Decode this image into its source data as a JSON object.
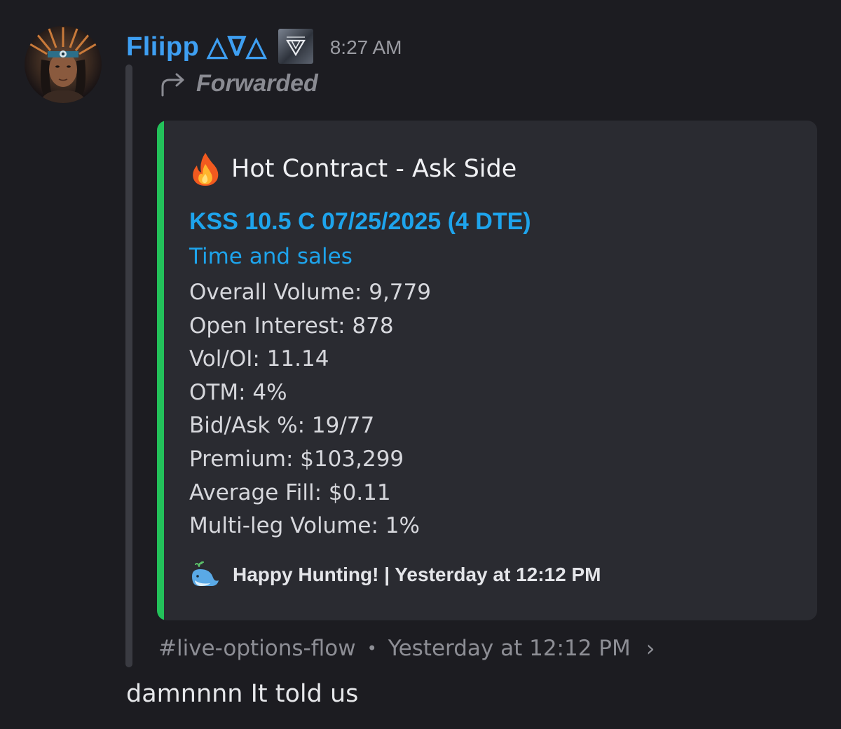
{
  "message": {
    "username": "Fliipp △∇△",
    "timestamp": "8:27 AM",
    "forwarded_label": "Forwarded",
    "reply_text": "damnnnn It told us"
  },
  "embed": {
    "accent_color": "#23c15a",
    "title_icon": "fire-emoji",
    "title": "Hot Contract - Ask Side",
    "contract_link": "KSS 10.5 C 07/25/2025 (4 DTE)",
    "sales_link": "Time and sales",
    "stats": [
      "Overall Volume: 9,779",
      "Open Interest: 878",
      "Vol/OI: 11.14",
      "OTM: 4%",
      "Bid/Ask %: 19/77",
      "Premium: $103,299",
      "Average Fill: $0.11",
      "Multi-leg Volume: 1%"
    ],
    "footer_icon": "whale-emoji",
    "footer_text": "Happy Hunting! | Yesterday at 12:12 PM"
  },
  "source": {
    "channel": "#live-options-flow",
    "separator": "•",
    "time": "Yesterday at 12:12 PM",
    "chevron": "›"
  },
  "colors": {
    "background": "#1c1c21",
    "username": "#3e9ff2",
    "link": "#1ea4ec",
    "embed_bg": "#2a2b31"
  }
}
